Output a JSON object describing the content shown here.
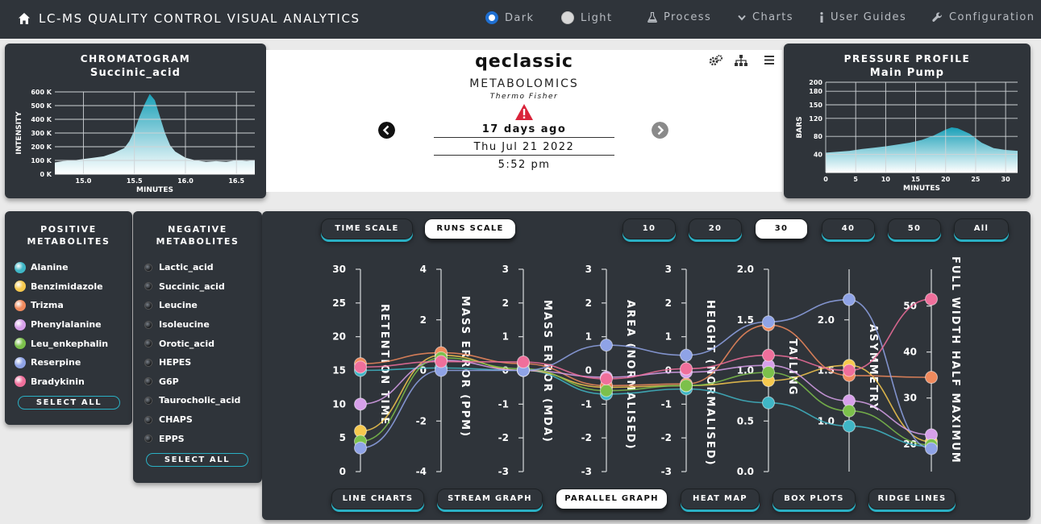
{
  "nav": {
    "title": "LC-MS QUALITY CONTROL VISUAL ANALYTICS",
    "dark": "Dark",
    "light": "Light",
    "process": "Process",
    "charts": "Charts",
    "guides": "User Guides",
    "config": "Configuration"
  },
  "chromatogram": {
    "title": "CHROMATOGRAM",
    "subtitle": "Succinic_acid",
    "ylabel": "INTENSITY",
    "xlabel": "MINUTES",
    "yticks": [
      "0 K",
      "100 K",
      "200 K",
      "300 K",
      "400 K",
      "500 K",
      "600 K"
    ],
    "xticks": [
      "15.0",
      "15.5",
      "16.0",
      "16.5"
    ]
  },
  "instrument": {
    "name": "qeclassic",
    "category": "METABOLOMICS",
    "vendor": "Thermo Fisher",
    "ago": "17 days ago",
    "date": "Thu Jul 21 2022",
    "time": "5:52 pm"
  },
  "pressure": {
    "title": "PRESSURE PROFILE",
    "subtitle": "Main Pump",
    "ylabel": "BARS",
    "xlabel": "MINUTES",
    "yticks": [
      "40",
      "80",
      "120",
      "150",
      "180",
      "200"
    ],
    "xticks": [
      "0",
      "5",
      "10",
      "15",
      "20",
      "25",
      "30"
    ]
  },
  "positive": {
    "title1": "POSITIVE",
    "title2": "METABOLITES",
    "items": [
      {
        "name": "Alanine",
        "color": "#3fb6c6"
      },
      {
        "name": "Benzimidazole",
        "color": "#f6c94e"
      },
      {
        "name": "Trizma",
        "color": "#f08a5d"
      },
      {
        "name": "Phenylalanine",
        "color": "#d7a0ea"
      },
      {
        "name": "Leu_enkephalin",
        "color": "#7cc04b"
      },
      {
        "name": "Reserpine",
        "color": "#8fa3e6"
      },
      {
        "name": "Bradykinin",
        "color": "#ef6f9b"
      }
    ],
    "select_all": "SELECT ALL"
  },
  "negative": {
    "title1": "NEGATIVE",
    "title2": "METABOLITES",
    "items": [
      "Lactic_acid",
      "Succinic_acid",
      "Leucine",
      "Isoleucine",
      "Orotic_acid",
      "HEPES",
      "G6P",
      "Taurocholic_acid",
      "CHAPS",
      "EPPS"
    ],
    "select_all": "SELECT ALL"
  },
  "scale_buttons": {
    "time": "TIME SCALE",
    "runs": "RUNS SCALE"
  },
  "count_buttons": [
    "10",
    "20",
    "30",
    "40",
    "50",
    "All"
  ],
  "view_buttons": [
    "LINE CHARTS",
    "STREAM GRAPH",
    "PARALLEL GRAPH",
    "HEAT MAP",
    "BOX PLOTS",
    "RIDGE LINES"
  ],
  "chart_data": [
    {
      "type": "area",
      "title": "CHROMATOGRAM",
      "subtitle": "Succinic_acid",
      "xlabel": "MINUTES",
      "ylabel": "INTENSITY",
      "xlim": [
        14.72,
        16.68
      ],
      "ylim": [
        0,
        600000
      ],
      "x": [
        14.72,
        14.8,
        14.9,
        15.0,
        15.1,
        15.2,
        15.3,
        15.4,
        15.45,
        15.5,
        15.55,
        15.6,
        15.65,
        15.7,
        15.75,
        15.8,
        15.85,
        15.9,
        16.0,
        16.1,
        16.2,
        16.3,
        16.4,
        16.5,
        16.6,
        16.68
      ],
      "y": [
        85000,
        95000,
        100000,
        110000,
        120000,
        130000,
        155000,
        190000,
        240000,
        320000,
        420000,
        510000,
        585000,
        540000,
        420000,
        300000,
        210000,
        165000,
        120000,
        100000,
        90000,
        95000,
        90000,
        100000,
        95000,
        100000
      ]
    },
    {
      "type": "area",
      "title": "PRESSURE PROFILE",
      "subtitle": "Main Pump",
      "xlabel": "MINUTES",
      "ylabel": "BARS",
      "xlim": [
        0,
        32
      ],
      "ylim": [
        0,
        200
      ],
      "x": [
        0,
        2,
        4,
        6,
        8,
        10,
        12,
        14,
        16,
        18,
        20,
        21,
        22,
        24,
        26,
        28,
        30,
        32
      ],
      "y": [
        44,
        46,
        48,
        52,
        55,
        58,
        62,
        66,
        72,
        82,
        95,
        100,
        98,
        86,
        66,
        54,
        50,
        48
      ]
    },
    {
      "type": "parallel",
      "axes": [
        {
          "name": "RETENTION TIME",
          "min": 0,
          "max": 30,
          "ticks": [
            0,
            5,
            10,
            15,
            20,
            25,
            30
          ]
        },
        {
          "name": "MASS ERROR (PPM)",
          "min": -4,
          "max": 4,
          "ticks": [
            -4,
            -2,
            0,
            2,
            4
          ]
        },
        {
          "name": "MASS ERROR (MDA)",
          "min": -3,
          "max": 3,
          "ticks": [
            -3,
            -2,
            -1,
            0,
            1,
            2,
            3
          ]
        },
        {
          "name": "AREA (NORMALISED)",
          "min": -3,
          "max": 3,
          "ticks": [
            -3,
            -2,
            -1,
            0,
            1,
            2,
            3
          ]
        },
        {
          "name": "HEIGHT (NORMALISED)",
          "min": -3,
          "max": 3,
          "ticks": [
            -3,
            -2,
            -1,
            0,
            1,
            2,
            3
          ]
        },
        {
          "name": "TAILING",
          "min": 0,
          "max": 2,
          "ticks": [
            "0.0",
            "0.5",
            "1.0",
            "1.5",
            "2.0"
          ]
        },
        {
          "name": "ASYMMETRY",
          "min": 0.5,
          "max": 2.5,
          "ticks": [
            "1.0",
            "1.5",
            "2.0"
          ]
        },
        {
          "name": "FULL WIDTH HALF MAXIMUM",
          "min": 14,
          "max": 58,
          "ticks": [
            20,
            30,
            40,
            50
          ]
        }
      ],
      "series": [
        {
          "name": "Alanine",
          "color": "#3fb6c6",
          "values": [
            15,
            0.1,
            0.0,
            -0.7,
            -0.55,
            0.68,
            0.95,
            19.5
          ]
        },
        {
          "name": "Benzimidazole",
          "color": "#f6c94e",
          "values": [
            6,
            0.6,
            0.0,
            -0.5,
            -0.45,
            0.9,
            1.55,
            20.5
          ]
        },
        {
          "name": "Trizma",
          "color": "#f08a5d",
          "values": [
            16,
            0.7,
            0.2,
            -0.45,
            -0.4,
            1.45,
            1.45,
            34.5
          ]
        },
        {
          "name": "Phenylalanine",
          "color": "#d7a0ea",
          "values": [
            10,
            0.4,
            0.0,
            -0.2,
            -0.05,
            1.05,
            1.2,
            22
          ]
        },
        {
          "name": "Leu_enkephalin",
          "color": "#7cc04b",
          "values": [
            4.5,
            0.5,
            0.05,
            -0.6,
            -0.45,
            0.98,
            1.1,
            19.8
          ]
        },
        {
          "name": "Reserpine",
          "color": "#8fa3e6",
          "values": [
            3.5,
            0.0,
            0.0,
            0.75,
            0.45,
            1.48,
            2.2,
            19.0
          ]
        },
        {
          "name": "Bradykinin",
          "color": "#ef6f9b",
          "values": [
            15.5,
            0.35,
            0.25,
            -0.25,
            0.05,
            1.15,
            1.5,
            51.5
          ]
        }
      ]
    }
  ]
}
